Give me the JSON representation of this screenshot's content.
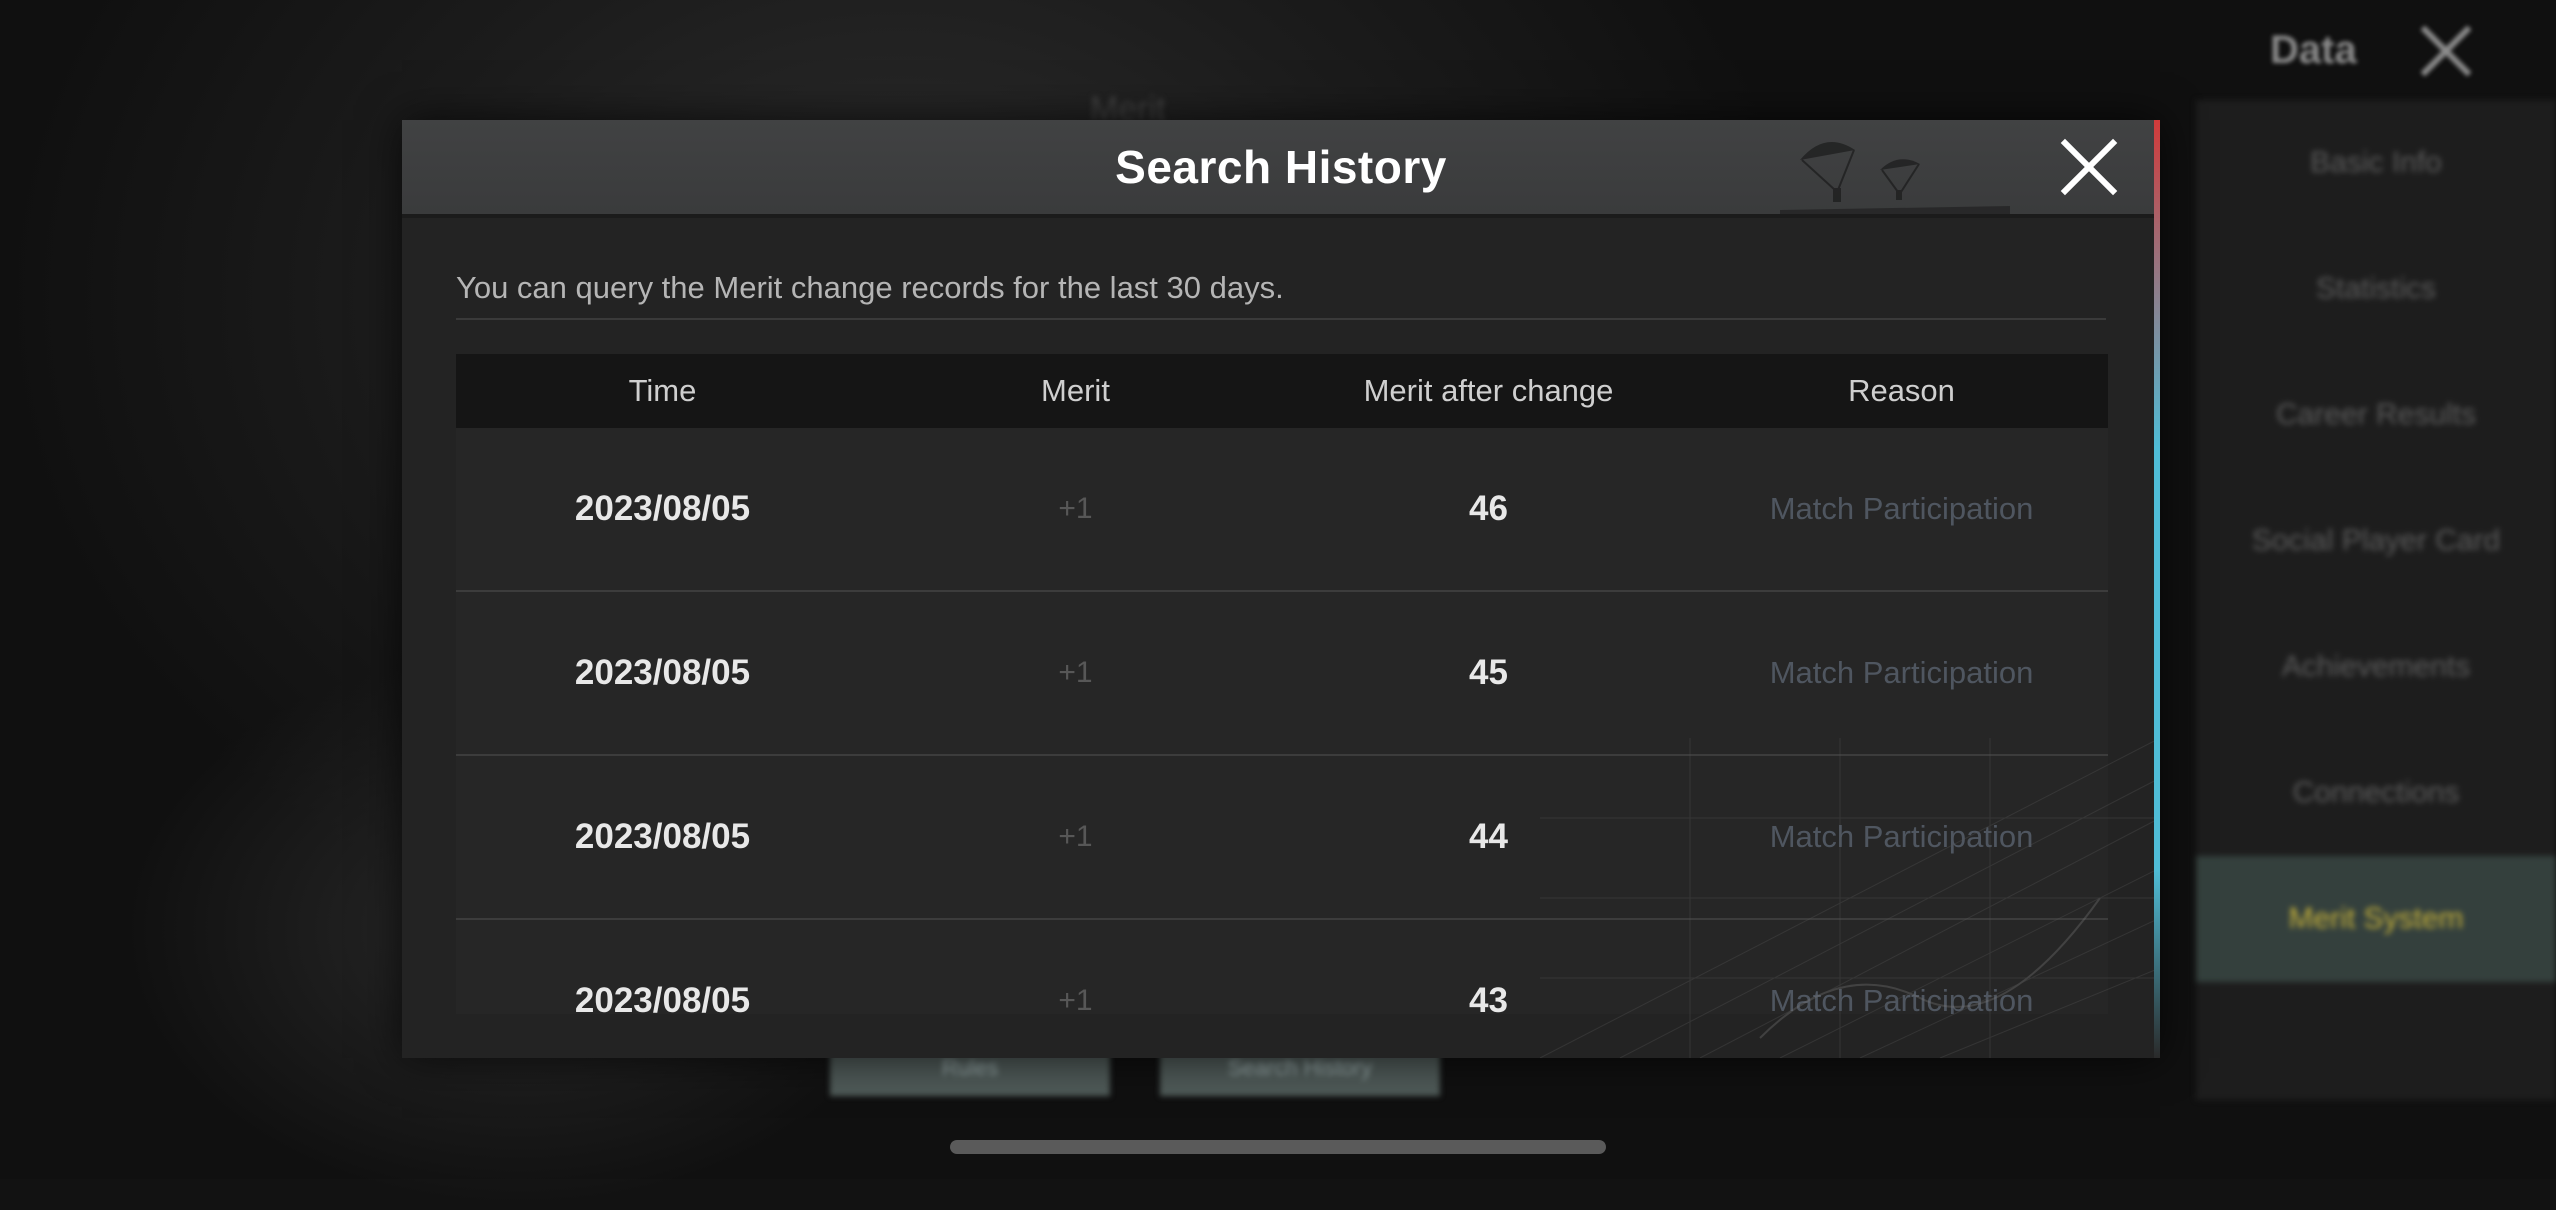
{
  "background": {
    "top_right_label": "Data",
    "heading": "Merit",
    "menu_items": [
      {
        "label": "Basic Info",
        "active": false
      },
      {
        "label": "Statistics",
        "active": false
      },
      {
        "label": "Career Results",
        "active": false
      },
      {
        "label": "Social Player Card",
        "active": false
      },
      {
        "label": "Achievements",
        "active": false
      },
      {
        "label": "Connections",
        "active": false
      },
      {
        "label": "Merit System",
        "active": true
      }
    ],
    "buttons": [
      "Rules",
      "Search History"
    ]
  },
  "dialog": {
    "title": "Search History",
    "info": "You can query the Merit change records for the last 30 days.",
    "columns": [
      "Time",
      "Merit",
      "Merit after change",
      "Reason"
    ],
    "rows": [
      {
        "time": "2023/08/05",
        "merit": "+1",
        "after": "46",
        "reason": "Match Participation"
      },
      {
        "time": "2023/08/05",
        "merit": "+1",
        "after": "45",
        "reason": "Match Participation"
      },
      {
        "time": "2023/08/05",
        "merit": "+1",
        "after": "44",
        "reason": "Match Participation"
      },
      {
        "time": "2023/08/05",
        "merit": "+1",
        "after": "43",
        "reason": "Match Participation"
      }
    ]
  },
  "icons": {
    "close": "close-icon",
    "decoration": "parachute-icon"
  }
}
